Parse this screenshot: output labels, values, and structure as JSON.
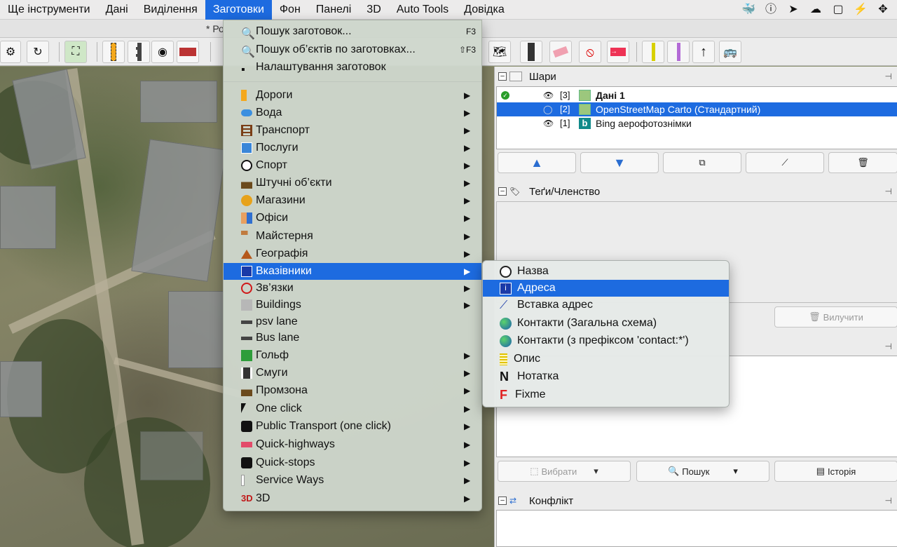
{
  "menubar": {
    "items": [
      "Ще інструменти",
      "Дані",
      "Виділення",
      "Заготовки",
      "Фон",
      "Панелі",
      "3D",
      "Auto Tools",
      "Довідка"
    ],
    "active_index": 3
  },
  "window": {
    "title": "* Ро"
  },
  "presets_menu": {
    "top_items": [
      {
        "label": "Пошук заготовок...",
        "shortcut": "F3",
        "icon": "search-icon"
      },
      {
        "label": "Пошук об’єктів по заготовках...",
        "shortcut": "⇧F3",
        "icon": "search-icon"
      },
      {
        "label": "Налаштування заготовок",
        "shortcut": "",
        "icon": "settings-icon"
      }
    ],
    "groups": [
      {
        "label": "Дороги",
        "icon": "road-icon",
        "submenu": true
      },
      {
        "label": "Вода",
        "icon": "water-icon",
        "submenu": true
      },
      {
        "label": "Транспорт",
        "icon": "railway-icon",
        "submenu": true
      },
      {
        "label": "Послуги",
        "icon": "bed-icon",
        "submenu": true
      },
      {
        "label": "Спорт",
        "icon": "soccer-ball-icon",
        "submenu": true
      },
      {
        "label": "Штучні об’єкти",
        "icon": "factory-icon",
        "submenu": true
      },
      {
        "label": "Магазини",
        "icon": "shopping-icon",
        "submenu": true
      },
      {
        "label": "Офіси",
        "icon": "office-icon",
        "submenu": true
      },
      {
        "label": "Майстерня",
        "icon": "paint-roller-icon",
        "submenu": true
      },
      {
        "label": "Географія",
        "icon": "mountain-icon",
        "submenu": true
      },
      {
        "label": "Вказівники",
        "icon": "info-sign-icon",
        "submenu": true,
        "highlighted": true
      },
      {
        "label": "Зв’язки",
        "icon": "relation-icon",
        "submenu": true
      },
      {
        "label": "Buildings",
        "icon": "building-icon",
        "submenu": true
      },
      {
        "label": "psv lane",
        "icon": "bus-lane-icon",
        "submenu": false
      },
      {
        "label": "Bus lane",
        "icon": "bus-lane-icon",
        "submenu": false
      },
      {
        "label": "Гольф",
        "icon": "golf-icon",
        "submenu": true
      },
      {
        "label": "Смуги",
        "icon": "lanes-icon",
        "submenu": true
      },
      {
        "label": "Промзона",
        "icon": "factory-icon",
        "submenu": true
      },
      {
        "label": "One click",
        "icon": "cursor-icon",
        "submenu": true
      },
      {
        "label": "Public Transport (one click)",
        "icon": "bus-icon",
        "submenu": true
      },
      {
        "label": "Quick-highways",
        "icon": "highway-icon",
        "submenu": true
      },
      {
        "label": "Quick-stops",
        "icon": "bus-stop-icon",
        "submenu": true
      },
      {
        "label": "Service Ways",
        "icon": "service-way-icon",
        "submenu": true
      },
      {
        "label": "3D",
        "icon": "3d-icon",
        "submenu": true
      }
    ]
  },
  "annotations_submenu": [
    {
      "label": "Назва",
      "icon": "speech-bubble-icon"
    },
    {
      "label": "Адреса",
      "icon": "info-sign-icon",
      "highlighted": true
    },
    {
      "label": "Вставка адрес",
      "icon": "interpolation-icon"
    },
    {
      "label": "Контакти (Загальна схема)",
      "icon": "globe-icon"
    },
    {
      "label": "Контакти (з префіксом 'contact:*')",
      "icon": "globe-icon"
    },
    {
      "label": "Опис",
      "icon": "notes-icon"
    },
    {
      "label": "Нотатка",
      "icon": "note-n-icon"
    },
    {
      "label": "Fixme",
      "icon": "fixme-f-icon"
    }
  ],
  "layers_panel": {
    "title": "Шари",
    "layers": [
      {
        "index": "[3]",
        "name": "Дані 1",
        "visible": true,
        "active": true,
        "bold": true
      },
      {
        "index": "[2]",
        "name": "OpenStreetMap Carto (Стандартний)",
        "visible": false,
        "selected": true
      },
      {
        "index": "[1]",
        "name": "Bing аерофотознімки",
        "visible": true
      }
    ]
  },
  "tags_panel": {
    "title": "Теґи/Членство",
    "delete_label": "Вилучити"
  },
  "selection_panel": {
    "select_label": "Вибрати",
    "search_label": "Пошук",
    "history_label": "Історія"
  },
  "conflict_panel": {
    "title": "Конфлікт"
  },
  "colors": {
    "accent": "#1d6be0",
    "menu_bg": "#ced6cc"
  }
}
